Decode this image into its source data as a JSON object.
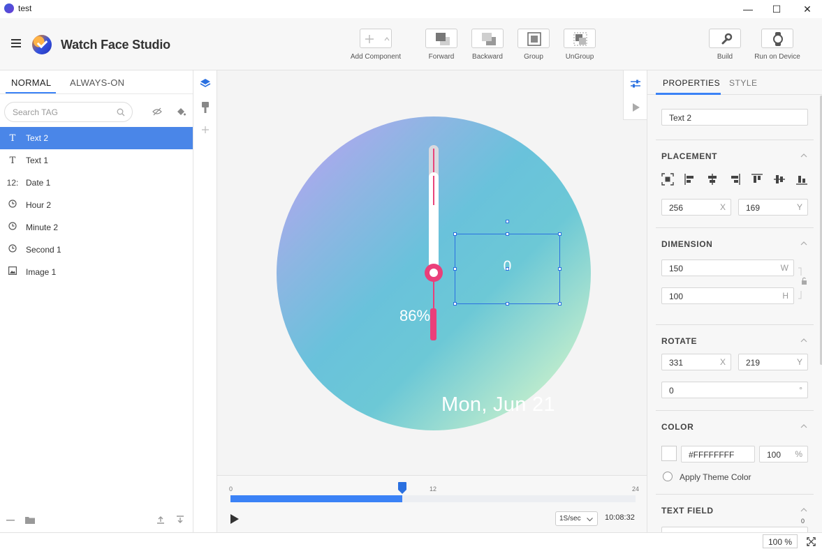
{
  "window": {
    "title": "test",
    "controls": {
      "minimize": "—",
      "maximize": "☐",
      "close": "✕"
    }
  },
  "header": {
    "brand": "Watch Face Studio",
    "buttons": [
      {
        "label": "Add Component",
        "icon": "add-icon"
      },
      {
        "label": "Forward",
        "icon": "forward-icon"
      },
      {
        "label": "Backward",
        "icon": "backward-icon"
      },
      {
        "label": "Group",
        "icon": "group-icon"
      },
      {
        "label": "UnGroup",
        "icon": "ungroup-icon"
      },
      {
        "label": "Build",
        "icon": "wrench-icon"
      },
      {
        "label": "Run on Device",
        "icon": "watch-icon"
      }
    ]
  },
  "left_panel": {
    "tabs": [
      "NORMAL",
      "ALWAYS-ON"
    ],
    "active_tab": "NORMAL",
    "search_placeholder": "Search TAG",
    "layers": [
      {
        "label": "Text 2",
        "icon": "T",
        "selected": true
      },
      {
        "label": "Text 1",
        "icon": "T",
        "selected": false
      },
      {
        "label": "Date 1",
        "icon": "12:",
        "selected": false
      },
      {
        "label": "Hour 2",
        "icon": "clock-icon",
        "selected": false
      },
      {
        "label": "Minute 2",
        "icon": "clock-icon",
        "selected": false
      },
      {
        "label": "Second 1",
        "icon": "clock-icon",
        "selected": false
      },
      {
        "label": "Image 1",
        "icon": "image-icon",
        "selected": false
      }
    ]
  },
  "canvas": {
    "battery_text": "86%",
    "date_text": "Mon, Jun 21",
    "selected_text": "0",
    "colors": {
      "accent": "#3b82f6",
      "hand": "#ea3f7a"
    }
  },
  "timeline": {
    "ticks": [
      "0",
      "12",
      "24"
    ],
    "progress": 0.424,
    "speed": "1S/sec",
    "time": "10:08:32"
  },
  "right_panel": {
    "tabs": [
      "PROPERTIES",
      "STYLE"
    ],
    "active_tab": "PROPERTIES",
    "name": "Text 2",
    "placement": {
      "title": "PLACEMENT",
      "x": "256",
      "y": "169",
      "x_label": "X",
      "y_label": "Y"
    },
    "dimension": {
      "title": "DIMENSION",
      "w": "150",
      "h": "100",
      "w_label": "W",
      "h_label": "H"
    },
    "rotate": {
      "title": "ROTATE",
      "x": "331",
      "y": "219",
      "x_label": "X",
      "y_label": "Y",
      "angle": "0",
      "angle_unit": "°"
    },
    "color": {
      "title": "COLOR",
      "hex": "#FFFFFFFF",
      "opacity": "100",
      "opacity_unit": "%",
      "theme_label": "Apply Theme Color"
    },
    "text_field": {
      "title": "TEXT FIELD",
      "count": "0"
    }
  },
  "status": {
    "zoom": "100 %"
  }
}
